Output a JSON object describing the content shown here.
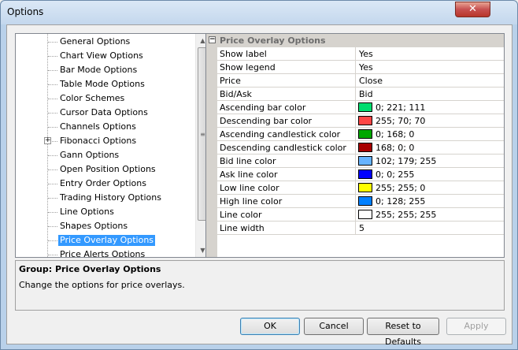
{
  "window": {
    "title": "Options",
    "close_glyph": "✕"
  },
  "tree": {
    "items": [
      {
        "label": "General Options",
        "selected": false
      },
      {
        "label": "Chart View Options",
        "selected": false
      },
      {
        "label": "Bar Mode Options",
        "selected": false
      },
      {
        "label": "Table Mode Options",
        "selected": false
      },
      {
        "label": "Color Schemes",
        "selected": false
      },
      {
        "label": "Cursor Data Options",
        "selected": false
      },
      {
        "label": "Channels Options",
        "selected": false
      },
      {
        "label": "Fibonacci Options",
        "selected": false,
        "expandable": true,
        "expander_glyph": "+"
      },
      {
        "label": "Gann Options",
        "selected": false
      },
      {
        "label": "Open Position Options",
        "selected": false
      },
      {
        "label": "Entry Order Options",
        "selected": false
      },
      {
        "label": "Trading History Options",
        "selected": false
      },
      {
        "label": "Line Options",
        "selected": false
      },
      {
        "label": "Shapes Options",
        "selected": false
      },
      {
        "label": "Price Overlay Options",
        "selected": true
      },
      {
        "label": "Price Alerts Options",
        "selected": false
      }
    ],
    "scroll_up_glyph": "▲",
    "scroll_down_glyph": "▼",
    "thumb_grip": "≡"
  },
  "grid": {
    "header": "Price Overlay Options",
    "collapse_glyph": "−",
    "rows": [
      {
        "name": "Show label",
        "value": "Yes"
      },
      {
        "name": "Show legend",
        "value": "Yes"
      },
      {
        "name": "Price",
        "value": "Close"
      },
      {
        "name": "Bid/Ask",
        "value": "Bid"
      },
      {
        "name": "Ascending bar color",
        "value": "0; 221; 111",
        "color": "#00dd6f"
      },
      {
        "name": "Descending bar color",
        "value": "255; 70; 70",
        "color": "#ff4646"
      },
      {
        "name": "Ascending candlestick color",
        "value": "0; 168; 0",
        "color": "#00a800"
      },
      {
        "name": "Descending candlestick color",
        "value": "168; 0; 0",
        "color": "#a80000"
      },
      {
        "name": "Bid line color",
        "value": "102; 179; 255",
        "color": "#66b3ff"
      },
      {
        "name": "Ask line color",
        "value": "0; 0; 255",
        "color": "#0000ff"
      },
      {
        "name": "Low line color",
        "value": "255; 255; 0",
        "color": "#ffff00"
      },
      {
        "name": "High line color",
        "value": "0; 128; 255",
        "color": "#0080ff"
      },
      {
        "name": "Line color",
        "value": "255; 255; 255",
        "color": "#ffffff"
      },
      {
        "name": "Line width",
        "value": "5"
      }
    ]
  },
  "description": {
    "title": "Group: Price Overlay Options",
    "text": "Change the options for price overlays."
  },
  "buttons": {
    "ok": "OK",
    "cancel": "Cancel",
    "reset": "Reset to Defaults",
    "apply": "Apply"
  }
}
